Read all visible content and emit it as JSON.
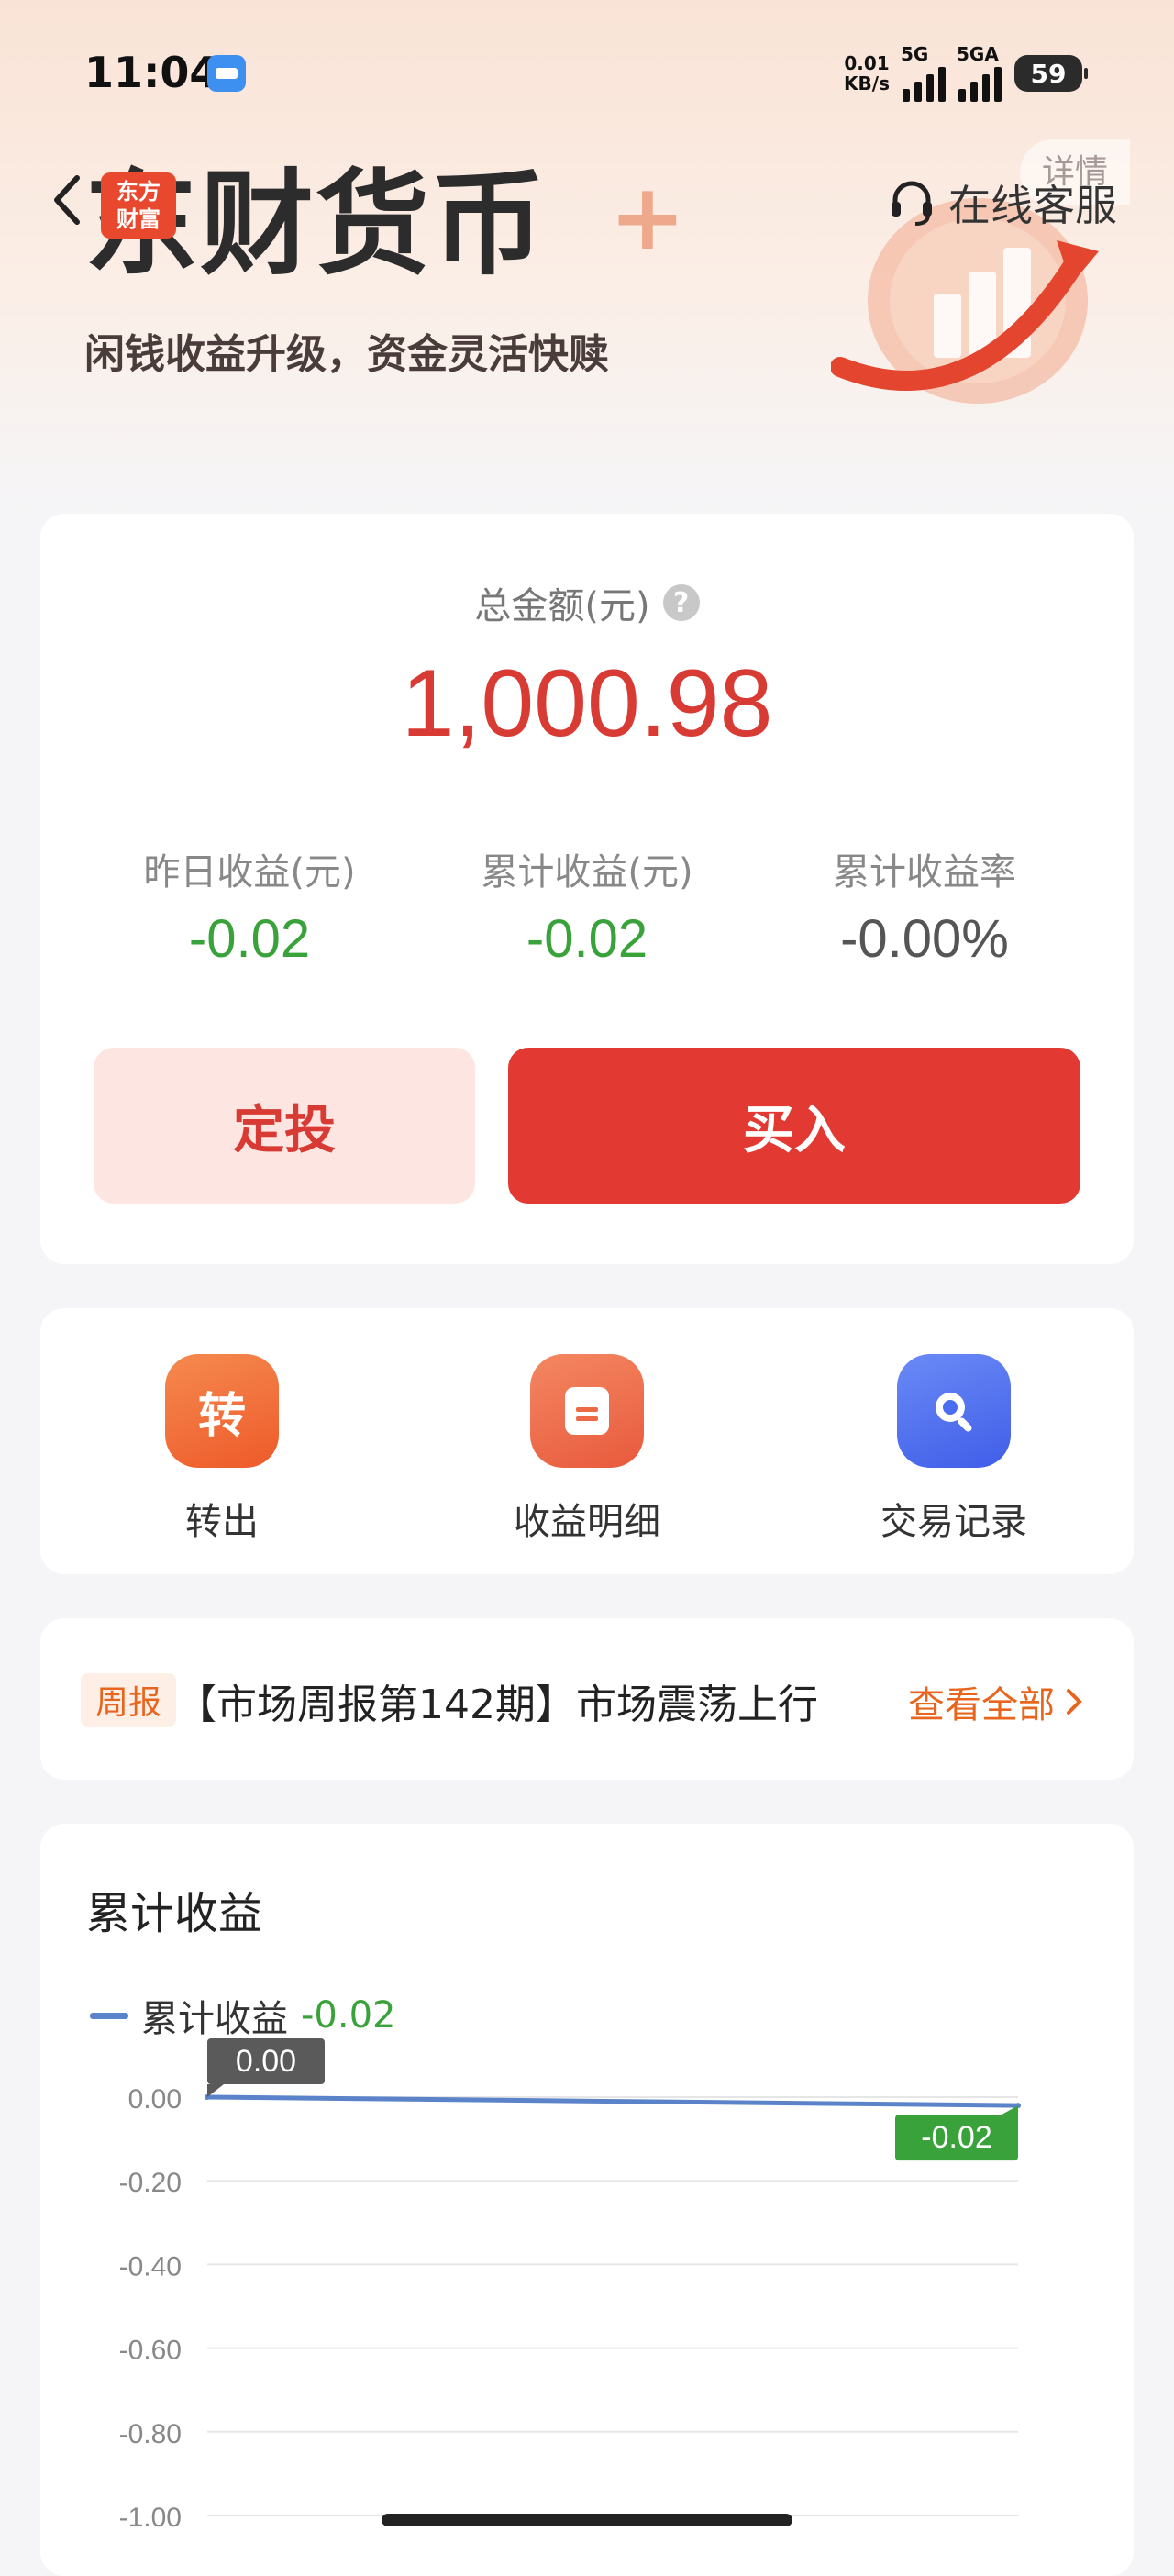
{
  "status_bar": {
    "time": "11:04",
    "net_speed_value": "0.01",
    "net_speed_unit": "KB/s",
    "signal1_label": "5G",
    "signal2_label": "5GA",
    "battery": "59"
  },
  "header": {
    "brand_logo_line1": "东方",
    "brand_logo_line2": "财富",
    "title": "东财货币",
    "title_suffix": "+",
    "slogan": "闲钱收益升级，资金灵活快赎",
    "detail": "详情",
    "customer_service": "在线客服"
  },
  "asset": {
    "total_label": "总金额(元)",
    "total_value": "1,000.98",
    "stats": [
      {
        "label": "昨日收益(元)",
        "value": "-0.02",
        "color": "#3aa23a"
      },
      {
        "label": "累计收益(元)",
        "value": "-0.02",
        "color": "#3aa23a"
      },
      {
        "label": "累计收益率",
        "value": "-0.00%",
        "color": "#555555"
      }
    ],
    "plan_button": "定投",
    "buy_button": "买入"
  },
  "actions": [
    {
      "label": "转出",
      "icon_text": "转",
      "icon": "transfer-icon",
      "color": "#f06a34"
    },
    {
      "label": "收益明细",
      "icon_text": "",
      "icon": "document-icon",
      "color": "#ec6a45"
    },
    {
      "label": "交易记录",
      "icon_text": "",
      "icon": "search-icon",
      "color": "#4a6cf0"
    }
  ],
  "news": {
    "tag": "周报",
    "title": "【市场周报第142期】市场震荡上行",
    "more": "查看全部"
  },
  "chart_section": {
    "title": "累计收益",
    "legend_name": "累计收益",
    "legend_value": "-0.02"
  },
  "chart_data": {
    "type": "line",
    "series": [
      {
        "name": "累计收益",
        "values": [
          0.0,
          -0.02
        ]
      }
    ],
    "ylim": [
      -1.0,
      0.0
    ],
    "yticks": [
      "0.00",
      "-0.20",
      "-0.40",
      "-0.60",
      "-0.80",
      "-1.00"
    ],
    "ytick_values": [
      0.0,
      -0.2,
      -0.4,
      -0.6,
      -0.8,
      -1.0
    ],
    "start_label": "0.00",
    "end_label": "-0.02",
    "line_color": "#5b83c9",
    "start_label_color": "#5a5a5a",
    "end_label_color": "#3aa23a",
    "grid": true
  }
}
